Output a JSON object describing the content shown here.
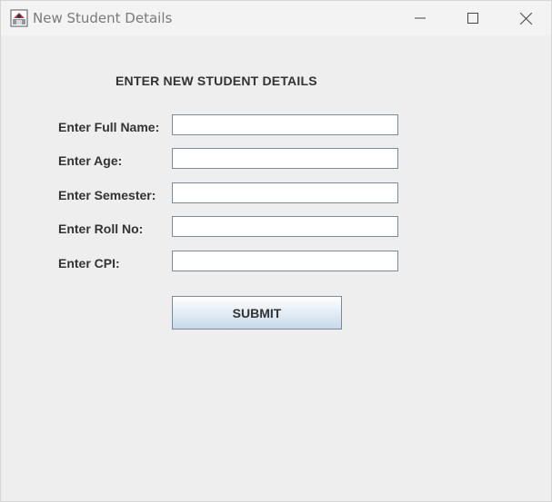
{
  "window": {
    "title": "New Student Details",
    "icon": "java-app-icon"
  },
  "form": {
    "heading": "ENTER NEW STUDENT DETAILS",
    "fields": [
      {
        "label": "Enter Full Name:",
        "value": ""
      },
      {
        "label": "Enter Age:",
        "value": ""
      },
      {
        "label": "Enter Semester:",
        "value": ""
      },
      {
        "label": "Enter Roll No:",
        "value": ""
      },
      {
        "label": "Enter CPI:",
        "value": ""
      }
    ],
    "submit_label": "SUBMIT"
  }
}
